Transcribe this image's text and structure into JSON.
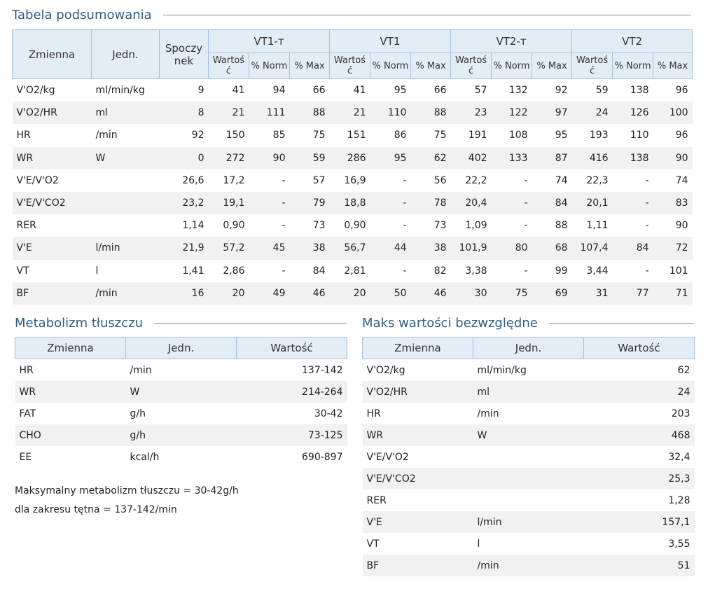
{
  "summary": {
    "title": "Tabela podsumowania",
    "headers": {
      "variable": "Zmienna",
      "unit": "Jedn.",
      "rest_line1": "Spoczy",
      "rest_line2": "nek",
      "groups": [
        "VT1-т",
        "VT1",
        "VT2-т",
        "VT2"
      ],
      "sub_value_line1": "Wartoś",
      "sub_value_line2": "ć",
      "sub_norm": "% Norm",
      "sub_max": "% Max"
    },
    "rows": [
      [
        "V'O2/kg",
        "ml/min/kg",
        "9",
        "41",
        "94",
        "66",
        "41",
        "95",
        "66",
        "57",
        "132",
        "92",
        "59",
        "138",
        "96"
      ],
      [
        "V'O2/HR",
        "ml",
        "8",
        "21",
        "111",
        "88",
        "21",
        "110",
        "88",
        "23",
        "122",
        "97",
        "24",
        "126",
        "100"
      ],
      [
        "HR",
        "/min",
        "92",
        "150",
        "85",
        "75",
        "151",
        "86",
        "75",
        "191",
        "108",
        "95",
        "193",
        "110",
        "96"
      ],
      [
        "WR",
        "W",
        "0",
        "272",
        "90",
        "59",
        "286",
        "95",
        "62",
        "402",
        "133",
        "87",
        "416",
        "138",
        "90"
      ],
      [
        "V'E/V'O2",
        "",
        "26,6",
        "17,2",
        "-",
        "57",
        "16,9",
        "-",
        "56",
        "22,2",
        "-",
        "74",
        "22,3",
        "-",
        "74"
      ],
      [
        "V'E/V'CO2",
        "",
        "23,2",
        "19,1",
        "-",
        "79",
        "18,8",
        "-",
        "78",
        "20,4",
        "-",
        "84",
        "20,1",
        "-",
        "83"
      ],
      [
        "RER",
        "",
        "1,14",
        "0,90",
        "-",
        "73",
        "0,90",
        "-",
        "73",
        "1,09",
        "-",
        "88",
        "1,11",
        "-",
        "90"
      ],
      [
        "V'E",
        "l/min",
        "21,9",
        "57,2",
        "45",
        "38",
        "56,7",
        "44",
        "38",
        "101,9",
        "80",
        "68",
        "107,4",
        "84",
        "72"
      ],
      [
        "VT",
        "l",
        "1,41",
        "2,86",
        "-",
        "84",
        "2,81",
        "-",
        "82",
        "3,38",
        "-",
        "99",
        "3,44",
        "-",
        "101"
      ],
      [
        "BF",
        "/min",
        "16",
        "20",
        "49",
        "46",
        "20",
        "50",
        "46",
        "30",
        "75",
        "69",
        "31",
        "77",
        "71"
      ]
    ]
  },
  "fat": {
    "title": "Metabolizm tłuszczu",
    "headers": [
      "Zmienna",
      "Jedn.",
      "Wartość"
    ],
    "rows": [
      [
        "HR",
        "/min",
        "137-142"
      ],
      [
        "WR",
        "W",
        "214-264"
      ],
      [
        "FAT",
        "g/h",
        "30-42"
      ],
      [
        "CHO",
        "g/h",
        "73-125"
      ],
      [
        "EE",
        "kcal/h",
        "690-897"
      ]
    ],
    "note_line1": "Maksymalny metabolizm tłuszczu = 30-42g/h",
    "note_line2": "dla zakresu tętna = 137-142/min"
  },
  "max": {
    "title": "Maks wartości bezwzględne",
    "headers": [
      "Zmienna",
      "Jedn.",
      "Wartość"
    ],
    "rows": [
      [
        "V'O2/kg",
        "ml/min/kg",
        "62"
      ],
      [
        "V'O2/HR",
        "ml",
        "24"
      ],
      [
        "HR",
        "/min",
        "203"
      ],
      [
        "WR",
        "W",
        "468"
      ],
      [
        "V'E/V'O2",
        "",
        "32,4"
      ],
      [
        "V'E/V'CO2",
        "",
        "25,3"
      ],
      [
        "RER",
        "",
        "1,28"
      ],
      [
        "V'E",
        "l/min",
        "157,1"
      ],
      [
        "VT",
        "l",
        "3,55"
      ],
      [
        "BF",
        "/min",
        "51"
      ]
    ]
  }
}
